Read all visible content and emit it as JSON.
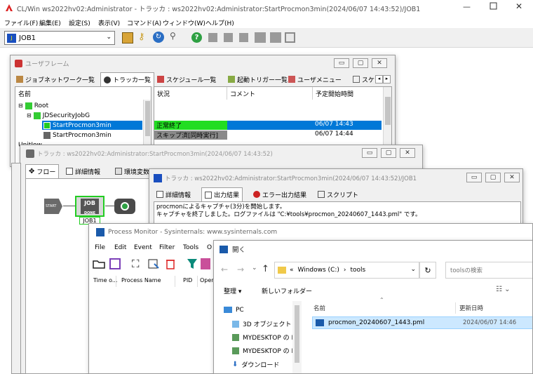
{
  "main": {
    "title": "CL/Win ws2022hv02:Administrator - トラッカ : ws2022hv02:Administrator:StartProcmon3min(2024/06/07 14:43:52)/JOB1",
    "menu": [
      "ファイル(F)",
      "編集(E)",
      "設定(S)",
      "表示(V)",
      "コマンド(A)",
      "ウィンドウ(W)",
      "ヘルプ(H)"
    ],
    "job_select_value": "JOB1"
  },
  "userframe": {
    "title": "ユーザフレーム",
    "tabs": [
      "ジョブネットワーク一覧",
      "トラッカ一覧",
      "スケジュール一覧",
      "起動トリガー一覧",
      "ユーザメニュー",
      "スケ"
    ],
    "tree_header": "名前",
    "tree": [
      "Root",
      "JDSecurityJobG",
      "StartProcmon3min",
      "StartProcmon3min",
      "UnitIow"
    ],
    "table_headers": [
      "状況",
      "コメント",
      "予定開始時間"
    ],
    "rows": [
      {
        "status": "正常終了",
        "comment": "",
        "time": "06/07 14:43"
      },
      {
        "status": "スキップ済[同時実行]",
        "comment": "",
        "time": "06/07 14:44"
      }
    ]
  },
  "tracker1": {
    "title": "トラッカ : ws2022hv02:Administrator:StartProcmon3min(2024/06/07 14:43:52)",
    "tabs": [
      "フロー",
      "詳細情報",
      "環境変数"
    ],
    "start_label": "START",
    "job_label": "JOB1",
    "job_text": "JOB",
    "job_small": "DONE"
  },
  "tracker2": {
    "title": "トラッカ : ws2022hv02:Administrator:StartProcmon3min(2024/06/07 14:43:52)/JOB1",
    "tabs": [
      "詳細情報",
      "出力結果",
      "エラー出力結果",
      "スクリプト"
    ],
    "output_lines": [
      "procmonによるキャプチャ(3分)を開始します。",
      "キャプチャを終了しました。ログファイルは \"C:¥tools¥procmon_20240607_1443.pml\" です。"
    ]
  },
  "procmon": {
    "title": "Process Monitor - Sysinternals: www.sysinternals.com",
    "menu": [
      "File",
      "Edit",
      "Event",
      "Filter",
      "Tools",
      "O"
    ],
    "columns": [
      "Time o...",
      "Process Name",
      "PID",
      "Opera"
    ]
  },
  "open_dialog": {
    "title": "開く",
    "path": [
      "Windows (C:)",
      "tools"
    ],
    "path_prefix": "«",
    "search_placeholder": "toolsの検索",
    "organize_label": "整理 ▾",
    "new_folder_label": "新しいフォルダー",
    "nav": [
      "PC",
      "3D オブジェクト",
      "MYDESKTOP の I",
      "MYDESKTOP の I",
      "ダウンロード"
    ],
    "col_name": "名前",
    "col_date": "更新日時",
    "file_name": "procmon_20240607_1443.pml",
    "file_date": "2024/06/07 14:46"
  }
}
